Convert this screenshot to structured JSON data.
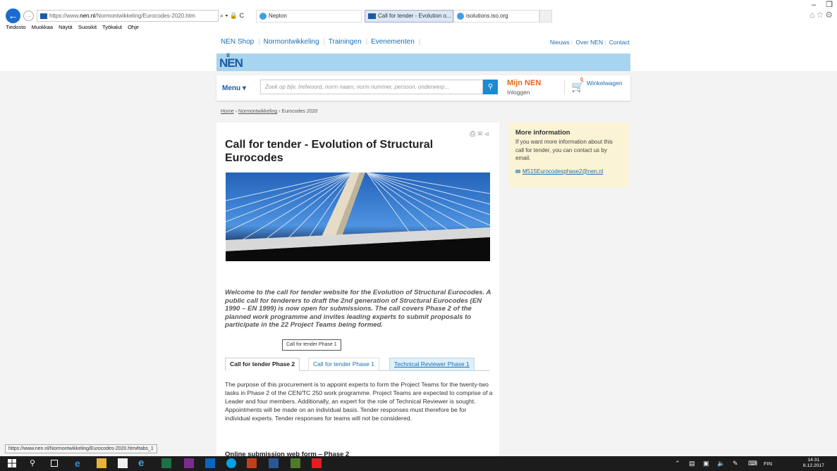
{
  "browser": {
    "url_prefix": "https://www.",
    "url_host": "nen.nl",
    "url_path": "/Normontwikkeling/Eurocodes-2020.htm",
    "addr_tools": "⌕ ▾ 🔒 C",
    "tabs": [
      {
        "label": "Nepton"
      },
      {
        "label": "Call for tender - Evolution o...  ×"
      },
      {
        "label": "isolutions.iso.org"
      }
    ],
    "menu": [
      "Tiedosto",
      "Muokkaa",
      "Näytä",
      "Suosikit",
      "Työkalut",
      "Ohje"
    ],
    "status_url": "https://www.nen.nl/Normontwikkeling/Eurocodes-2020.htm#tabs_1"
  },
  "site": {
    "topnav": [
      "NEN Shop",
      "Normontwikkeling",
      "Trainingen",
      "Evenementen"
    ],
    "topnav_right": [
      "Nieuws",
      "Over NEN",
      "Contact"
    ],
    "logo": "NEN",
    "menu_label": "Menu ▾",
    "search_placeholder": "Zoek op bijv. trefwoord, norm naam, norm nummer, persoon, onderwerp...",
    "mijn_nen": "Mijn NEN",
    "inloggen": "Inloggen",
    "cart_count": "0",
    "cart_label": "Winkelwagen"
  },
  "breadcrumb": [
    "Home",
    "Normontwikkeling",
    "Eurocodes 2020"
  ],
  "article": {
    "title": "Call for tender - Evolution of Structural Eurocodes",
    "intro": "Welcome to the call for tender website for the Evolution of Structural Eurocodes. A public call for tenderers to draft the 2nd generation of Structural Eurocodes (EN 1990 – EN 1999) is now open for submissions. The call covers Phase 2 of the planned work programme and invites leading experts to submit proposals to participate in the 22 Project Teams being formed.",
    "tooltip": "Call for tender Phase 1",
    "tabs": [
      "Call for tender Phase 2",
      "Call for tender Phase 1",
      "Technical Reviewer Phase 1"
    ],
    "body": "The purpose of this procurement is to appoint experts to form the Project Teams for the twenty-two tasks in Phase 2 of the CEN/TC 250 work programme. Project Teams are expected to comprise of a Leader and four members. Additionally, an expert for the role of Technical Reviewer is sought. Appointments will be made on an individual basis. Tender responses must therefore be for individual experts. Tender responses for teams will not be considered.",
    "sub_heading": "Online submission web form – Phase 2"
  },
  "info": {
    "title": "More information",
    "text": "If you want more information about this call for tender, you can contact us by email.",
    "email": "M515Eurocodesphase2@nen.nl"
  },
  "taskbar": {
    "lang": "FIN",
    "time": "14:31",
    "date": "8.12.2017"
  }
}
